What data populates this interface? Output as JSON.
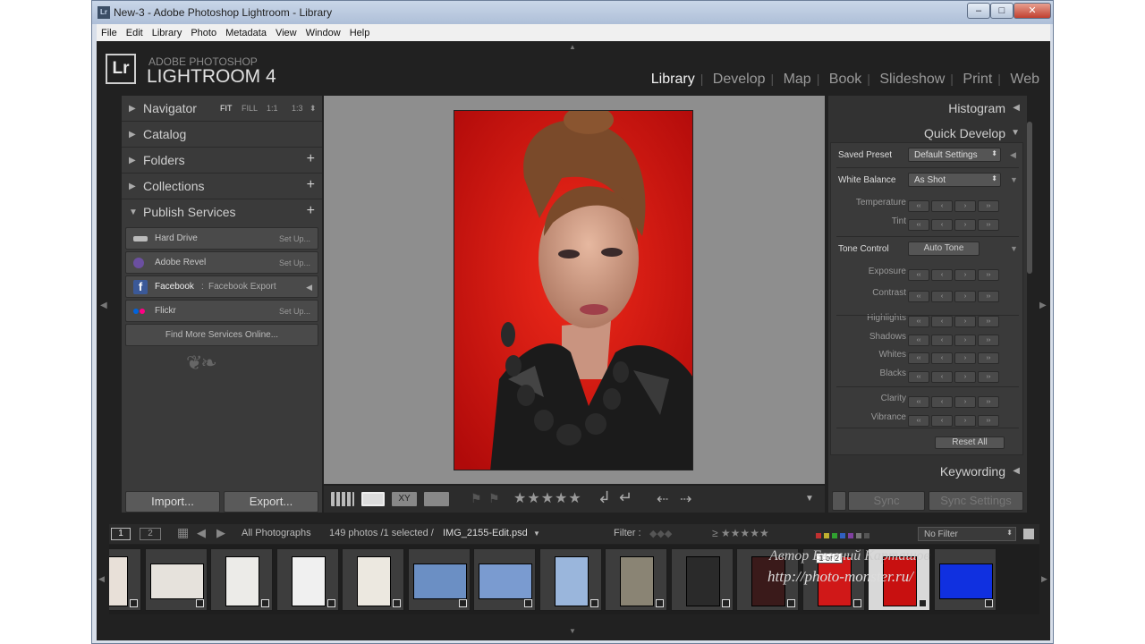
{
  "window": {
    "title": "New-3 - Adobe Photoshop Lightroom - Library",
    "app_icon": "Lr",
    "controls": [
      "minimize-icon",
      "maximize-icon",
      "close-icon"
    ]
  },
  "menu": [
    "File",
    "Edit",
    "Library",
    "Photo",
    "Metadata",
    "View",
    "Window",
    "Help"
  ],
  "identity": {
    "badge": "Lr",
    "line1": "ADOBE PHOTOSHOP",
    "line2": "LIGHTROOM 4"
  },
  "modules": {
    "items": [
      "Library",
      "Develop",
      "Map",
      "Book",
      "Slideshow",
      "Print",
      "Web"
    ],
    "active": "Library"
  },
  "left_panel": {
    "navigator": {
      "label": "Navigator",
      "options": [
        "FIT",
        "FILL",
        "1:1",
        "1:3"
      ]
    },
    "catalog": "Catalog",
    "folders": "Folders",
    "collections": "Collections",
    "publish": {
      "label": "Publish Services",
      "services": [
        {
          "name": "Hard Drive",
          "action": "Set Up...",
          "icon": "hard-drive-icon"
        },
        {
          "name": "Adobe Revel",
          "action": "Set Up...",
          "icon": "revel-icon"
        },
        {
          "name": "Facebook",
          "sub": "Facebook Export",
          "icon": "facebook-icon"
        },
        {
          "name": "Flickr",
          "action": "Set Up...",
          "icon": "flickr-icon"
        }
      ],
      "find_more": "Find More Services Online..."
    },
    "import": "Import...",
    "export": "Export..."
  },
  "right_panel": {
    "histogram": "Histogram",
    "quick_develop": "Quick Develop",
    "saved_preset": {
      "label": "Saved Preset",
      "value": "Default Settings"
    },
    "white_balance": {
      "label": "White Balance",
      "value": "As Shot"
    },
    "wb_rows": [
      "Temperature",
      "Tint"
    ],
    "tone_control": {
      "label": "Tone Control",
      "button": "Auto Tone"
    },
    "tone_rows": [
      "Exposure",
      "Contrast",
      "Highlights",
      "Shadows",
      "Whites",
      "Blacks",
      "Clarity",
      "Vibrance"
    ],
    "stepper_glyphs": {
      "down_large": "‹‹",
      "down": "‹",
      "up": "›",
      "up_large": "››"
    },
    "reset_all": "Reset All",
    "keywording": "Keywording",
    "sync": "Sync",
    "sync_settings": "Sync Settings"
  },
  "filmstrip_bar": {
    "monitor1": "1",
    "monitor2": "2",
    "source": "All Photographs",
    "count_prefix": "149 photos /1 selected /",
    "current_file": "IMG_2155-Edit.psd",
    "filter_label": "Filter :",
    "filter_value": "No Filter"
  },
  "filmstrip": {
    "stack_badge": "1 of 2",
    "thumbnails": [
      {
        "kind": "portrait",
        "bg": "#e8e0d8"
      },
      {
        "kind": "landscape",
        "bg": "#e6e2dc"
      },
      {
        "kind": "portrait",
        "bg": "#ecebe8"
      },
      {
        "kind": "portrait",
        "bg": "#f0f0f0"
      },
      {
        "kind": "portrait",
        "bg": "#ece8e0"
      },
      {
        "kind": "landscape",
        "bg": "#6b8fc4"
      },
      {
        "kind": "landscape",
        "bg": "#7a9bd0"
      },
      {
        "kind": "portrait",
        "bg": "#9ab6dc"
      },
      {
        "kind": "portrait",
        "bg": "#8a8474"
      },
      {
        "kind": "portrait",
        "bg": "#2a2a2a"
      },
      {
        "kind": "portrait",
        "bg": "#3a1a1a"
      },
      {
        "kind": "portrait",
        "bg": "#d01818"
      },
      {
        "kind": "portrait",
        "bg": "#c81010"
      },
      {
        "kind": "landscape",
        "bg": "#1030e0"
      }
    ]
  },
  "watermark": {
    "line1": "Автор Евгений Карташов",
    "line2": "http://photo-monster.ru/"
  },
  "colors": {
    "accent_red": "#d01010",
    "panel": "#3a3a3a",
    "background": "#212121"
  }
}
